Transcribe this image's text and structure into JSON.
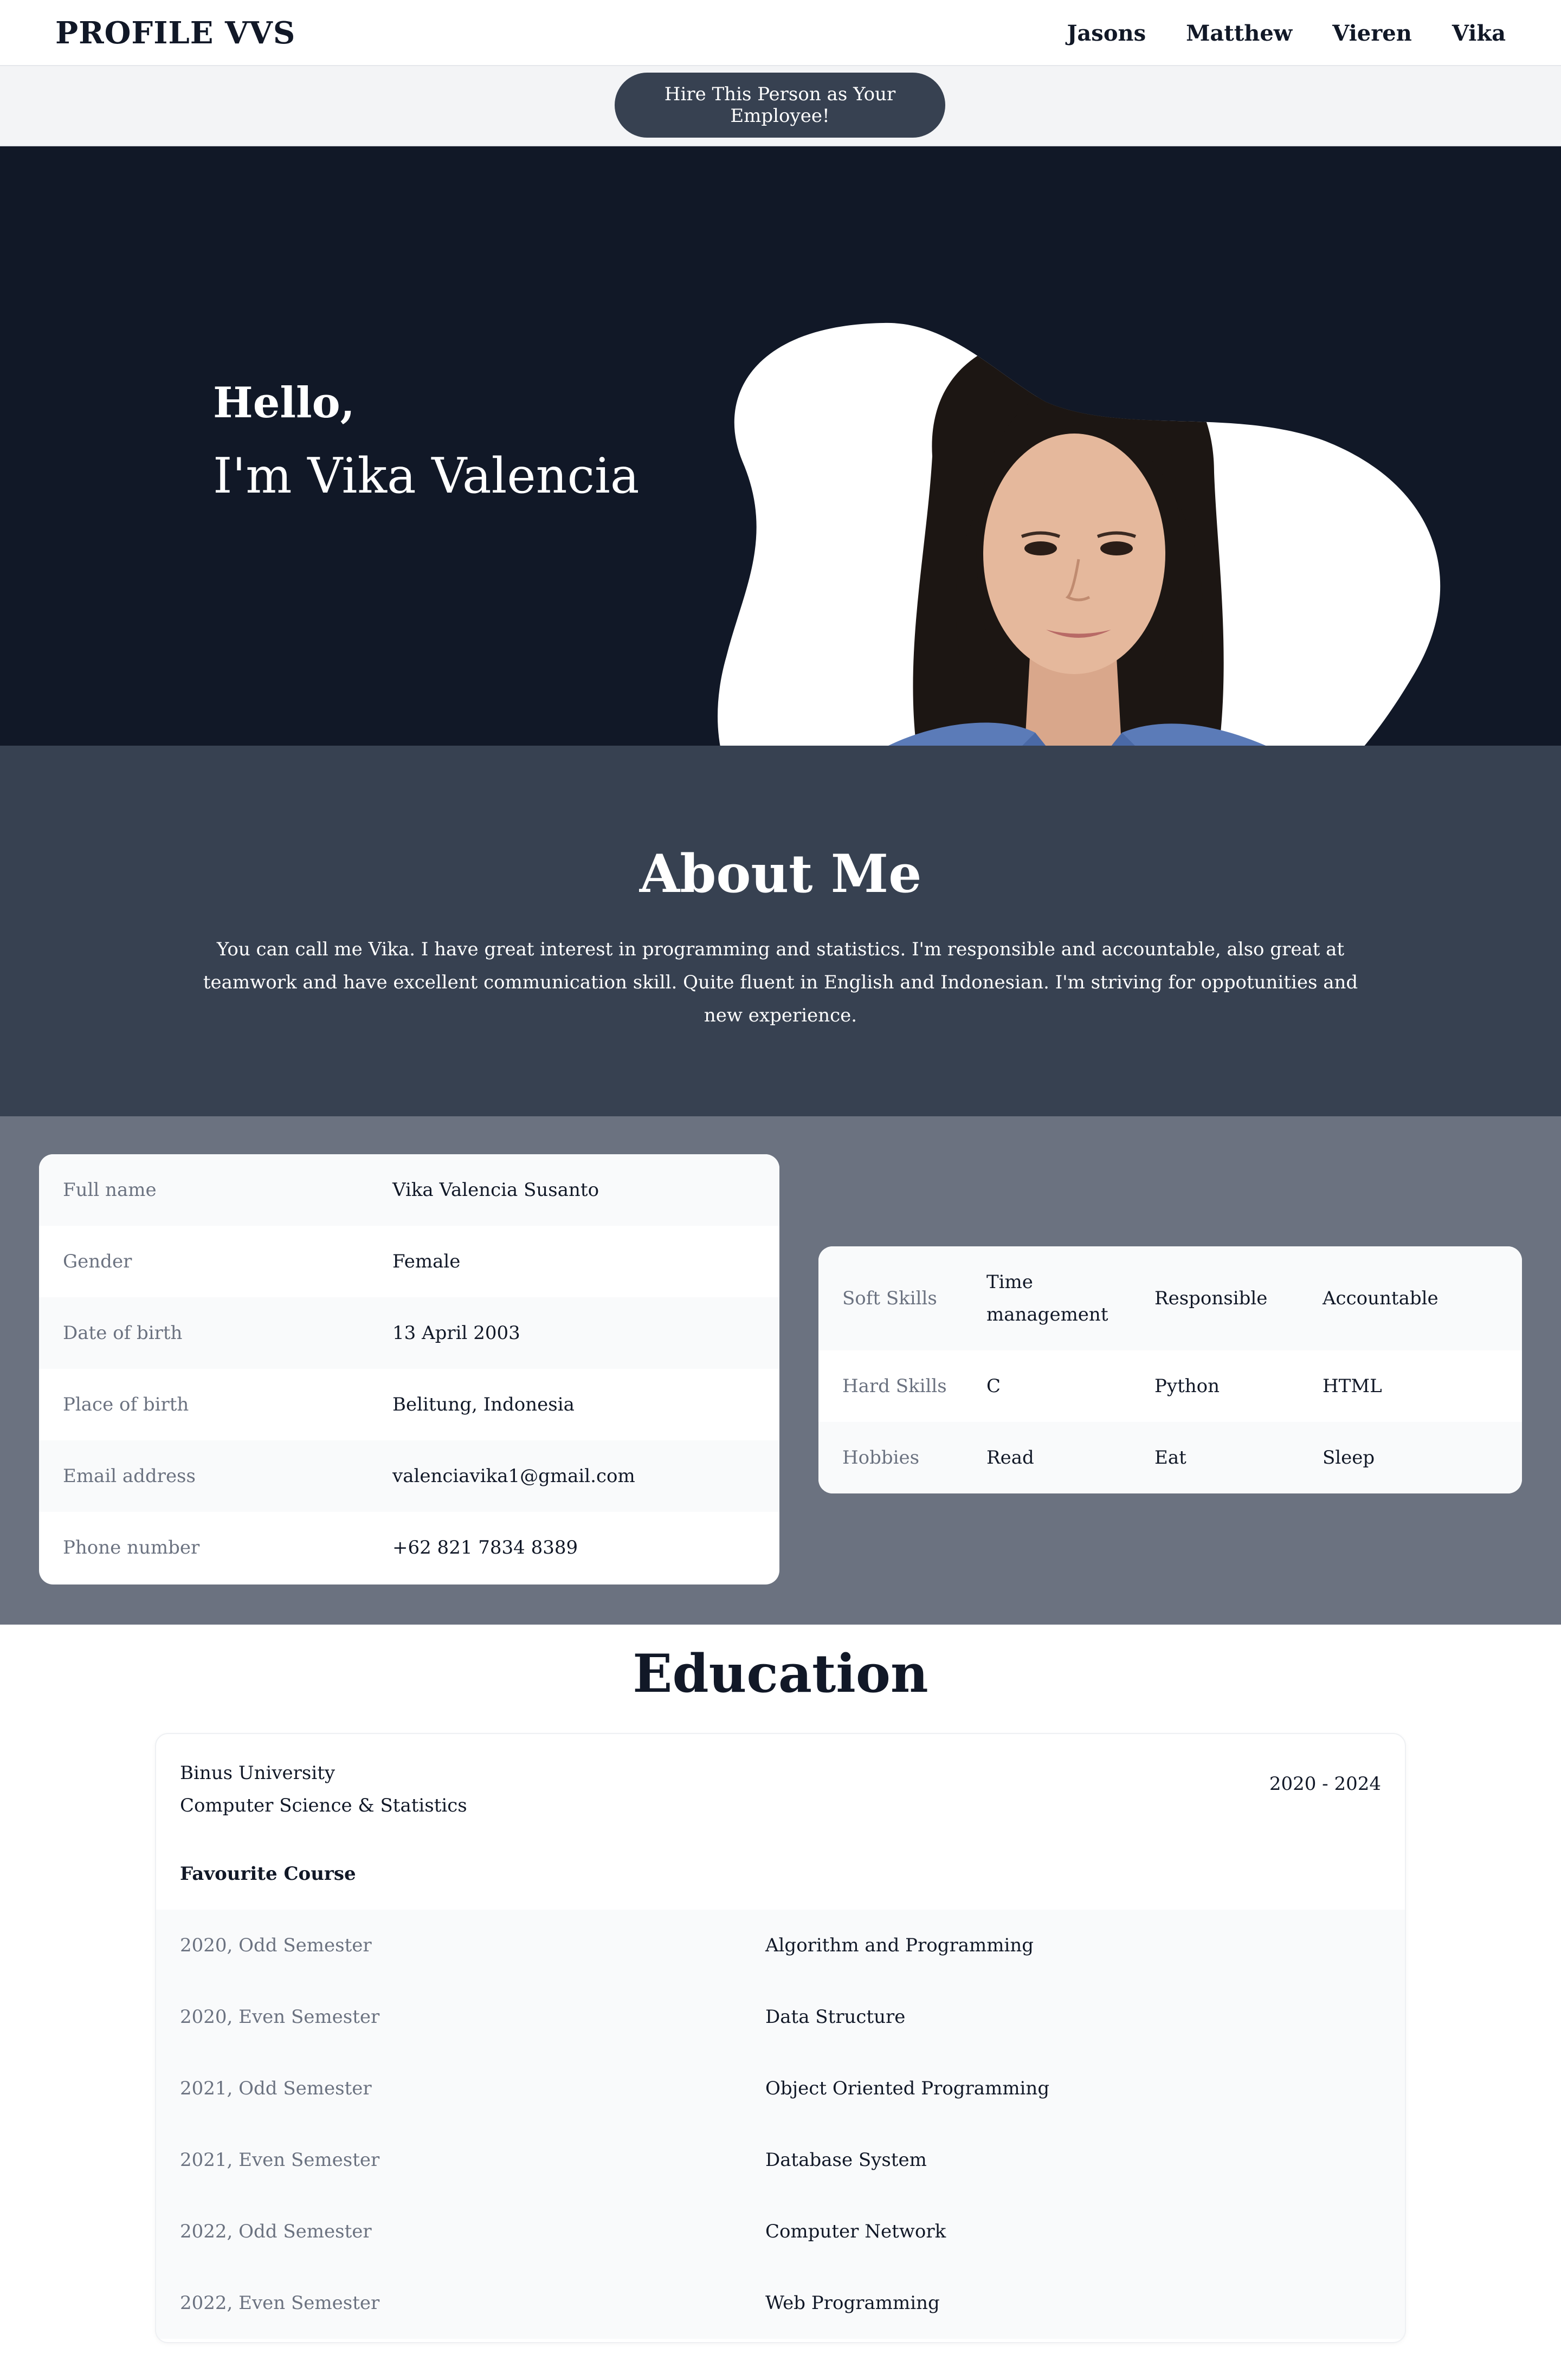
{
  "nav": {
    "brand": "PROFILE VVS",
    "links": [
      "Jasons",
      "Matthew",
      "Vieren",
      "Vika"
    ]
  },
  "hire_button": "Hire This Person as Your Employee!",
  "hero": {
    "greeting": "Hello,",
    "intro": "I'm Vika Valencia"
  },
  "about": {
    "title": "About Me",
    "text": "You can call me Vika. I have great interest in programming and statistics. I'm responsible and accountable, also great at teamwork and have excellent communication skill. Quite fluent in English and Indonesian. I'm striving for oppotunities and new experience."
  },
  "personal": [
    {
      "label": "Full name",
      "value": "Vika Valencia Susanto"
    },
    {
      "label": "Gender",
      "value": "Female"
    },
    {
      "label": "Date of birth",
      "value": "13 April 2003"
    },
    {
      "label": "Place of birth",
      "value": "Belitung, Indonesia"
    },
    {
      "label": "Email address",
      "value": "valenciavika1@gmail.com"
    },
    {
      "label": "Phone number",
      "value": "+62 821 7834 8389"
    }
  ],
  "skills": [
    {
      "label": "Soft Skills",
      "items": [
        "Time management",
        "Responsible",
        "Accountable"
      ]
    },
    {
      "label": "Hard Skills",
      "items": [
        "C",
        "Python",
        "HTML"
      ]
    },
    {
      "label": "Hobbies",
      "items": [
        "Read",
        "Eat",
        "Sleep"
      ]
    }
  ],
  "education": {
    "title": "Education",
    "school": "Binus University",
    "major": "Computer Science & Statistics",
    "years": "2020 - 2024",
    "favourite_heading": "Favourite Course",
    "courses": [
      {
        "semester": "2020, Odd Semester",
        "course": "Algorithm and Programming"
      },
      {
        "semester": "2020, Even Semester",
        "course": "Data Structure"
      },
      {
        "semester": "2021, Odd Semester",
        "course": "Object Oriented Programming"
      },
      {
        "semester": "2021, Even Semester",
        "course": "Database System"
      },
      {
        "semester": "2022, Odd Semester",
        "course": "Computer Network"
      },
      {
        "semester": "2022, Even Semester",
        "course": "Web Programming"
      }
    ]
  },
  "colors": {
    "hero_bg": "#111827",
    "about_bg": "#374151",
    "info_bg": "#6b7280",
    "button_bg": "#374151",
    "shirt": "#5b7bb8",
    "hair": "#1c1613",
    "skin": "#e5b89c"
  }
}
